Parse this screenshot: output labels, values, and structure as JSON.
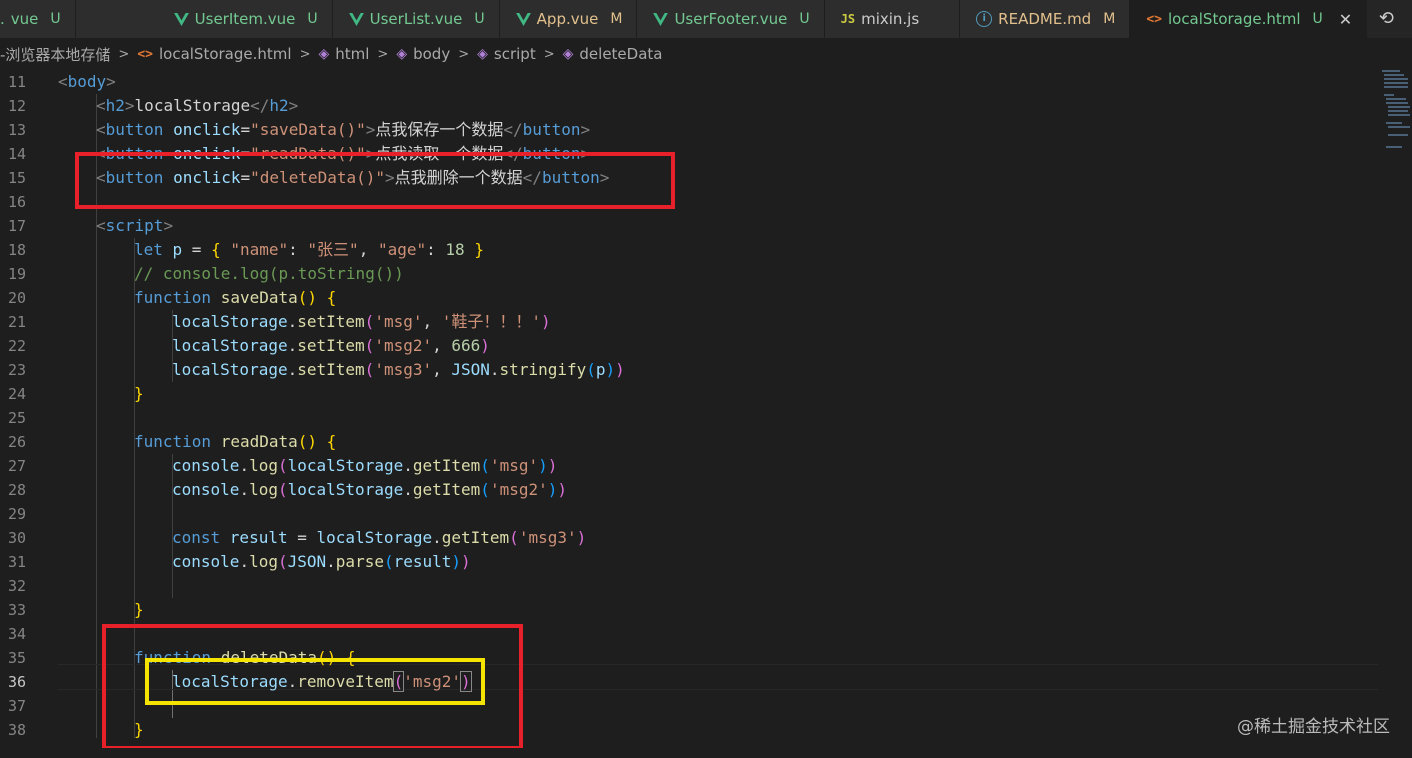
{
  "tabs": [
    {
      "name": "vue",
      "prefix": ".",
      "status": "U",
      "type": "vue"
    },
    {
      "name": "UserItem.vue",
      "status": "U",
      "type": "vue"
    },
    {
      "name": "UserList.vue",
      "status": "U",
      "type": "vue"
    },
    {
      "name": "App.vue",
      "status": "M",
      "type": "vue"
    },
    {
      "name": "UserFooter.vue",
      "status": "U",
      "type": "vue"
    },
    {
      "name": "mixin.js",
      "status": "",
      "type": "js"
    },
    {
      "name": "README.md",
      "status": "M",
      "type": "md"
    },
    {
      "name": "localStorage.html",
      "status": "U",
      "type": "html",
      "active": true
    }
  ],
  "icons": {
    "js": "JS",
    "html": "<>",
    "info": "i",
    "close": "✕",
    "history": "⟲"
  },
  "breadcrumb": {
    "folder": "-浏览器本地存储",
    "file": "localStorage.html",
    "items": [
      "html",
      "body",
      "script",
      "deleteData"
    ]
  },
  "editor": {
    "line_numbers": [
      "11",
      "12",
      "13",
      "14",
      "15",
      "16",
      "17",
      "18",
      "19",
      "20",
      "21",
      "22",
      "23",
      "24",
      "25",
      "26",
      "27",
      "28",
      "29",
      "30",
      "31",
      "32",
      "33",
      "34",
      "35",
      "36",
      "37",
      "38"
    ],
    "current_line": "36",
    "code": {
      "l11": {
        "a": "<",
        "b": "body",
        "c": ">"
      },
      "l12": {
        "a": "<",
        "b": "h2",
        "c": ">",
        "d": "localStorage",
        "e": "</",
        "f": "h2",
        "g": ">"
      },
      "l13": {
        "a": "<",
        "b": "button",
        "c": " ",
        "d": "onclick",
        "e": "=",
        "f": "\"saveData()\"",
        "g": ">",
        "h": "点我保存一个数据",
        "i": "</",
        "j": "button",
        "k": ">"
      },
      "l14": {
        "a": "<",
        "b": "button",
        "c": " ",
        "d": "onclick",
        "e": "=",
        "f": "\"readData()\"",
        "g": ">",
        "h": "点我读取一个数据",
        "i": "</",
        "j": "button",
        "k": ">"
      },
      "l15": {
        "a": "<",
        "b": "button",
        "c": " ",
        "d": "onclick",
        "e": "=",
        "f": "\"deleteData()\"",
        "g": ">",
        "h": "点我删除一个数据",
        "i": "</",
        "j": "button",
        "k": ">"
      },
      "l17": {
        "a": "<",
        "b": "script",
        "c": ">"
      },
      "l18": {
        "a": "let ",
        "b": "p",
        "c": " = ",
        "d": "{",
        "e": " ",
        "f": "\"name\"",
        "g": ": ",
        "h": "\"张三\"",
        "i": ", ",
        "j": "\"age\"",
        "k": ": ",
        "l": "18",
        "m": " ",
        "n": "}"
      },
      "l19": {
        "a": "// console.log(p.toString())"
      },
      "l20": {
        "a": "function ",
        "b": "saveData",
        "c": "()",
        "d": " {"
      },
      "l21": {
        "a": "localStorage",
        ".": ".",
        "b": "setItem",
        "c": "(",
        "d": "'msg'",
        "e": ", ",
        "f": "'鞋子！！！'",
        "g": ")"
      },
      "l22": {
        "a": "localStorage",
        ".": ".",
        "b": "setItem",
        "c": "(",
        "d": "'msg2'",
        "e": ", ",
        "f": "666",
        "g": ")"
      },
      "l23": {
        "a": "localStorage",
        ".": ".",
        "b": "setItem",
        "c": "(",
        "d": "'msg3'",
        "e": ", ",
        "f": "JSON",
        ".2": ".",
        "g": "stringify",
        "h": "(",
        "i": "p",
        "j": ")",
        "k": ")"
      },
      "l24": {
        "a": "}"
      },
      "l26": {
        "a": "function ",
        "b": "readData",
        "c": "()",
        "d": " {"
      },
      "l27": {
        "a": "console",
        ".": ".",
        "b": "log",
        "c": "(",
        "d": "localStorage",
        ".2": ".",
        "e": "getItem",
        "f": "(",
        "g": "'msg'",
        "h": ")",
        "i": ")"
      },
      "l28": {
        "a": "console",
        ".": ".",
        "b": "log",
        "c": "(",
        "d": "localStorage",
        ".2": ".",
        "e": "getItem",
        "f": "(",
        "g": "'msg2'",
        "h": ")",
        "i": ")"
      },
      "l30": {
        "a": "const ",
        "b": "result",
        "c": " = ",
        "d": "localStorage",
        ".": ".",
        "e": "getItem",
        "f": "(",
        "g": "'msg3'",
        "h": ")"
      },
      "l31": {
        "a": "console",
        ".": ".",
        "b": "log",
        "c": "(",
        "d": "JSON",
        ".2": ".",
        "e": "parse",
        "f": "(",
        "g": "result",
        "h": ")",
        "i": ")"
      },
      "l33": {
        "a": "}"
      },
      "l35": {
        "a": "function ",
        "b": "deleteData",
        "c": "()",
        "d": " {"
      },
      "l36": {
        "a": "localStorage",
        ".": ".",
        "b": "removeItem",
        "c": "(",
        "d": "'msg2'",
        "e": ")"
      },
      "l38": {
        "a": "}"
      }
    }
  },
  "watermark": "@稀土掘金技术社区",
  "highlight_colors": {
    "red": "#e8202a",
    "yellow": "#f5e400"
  }
}
